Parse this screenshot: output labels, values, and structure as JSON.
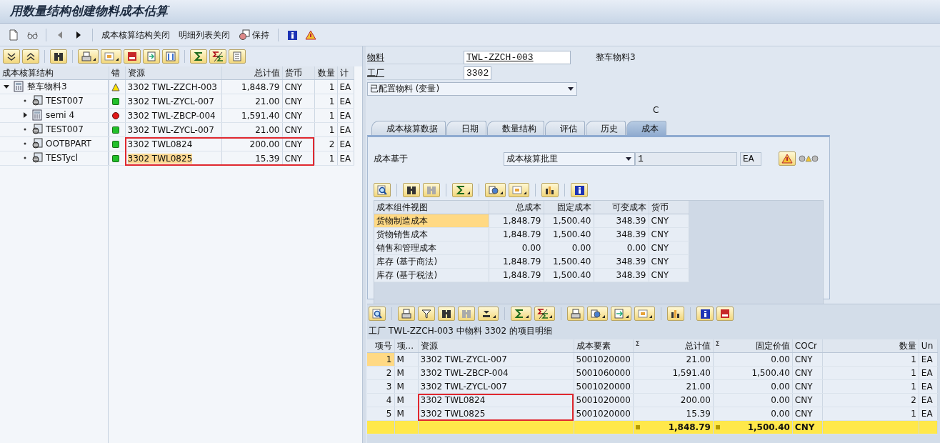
{
  "window": {
    "title": "用数量结构创建物料成本估算"
  },
  "toolbar": [
    {
      "kind": "text",
      "label": "成本核算结构关闭"
    },
    {
      "kind": "text",
      "label": "明细列表关闭"
    },
    {
      "kind": "icon_text",
      "label": "保持"
    }
  ],
  "tree": {
    "columns": [
      "成本核算结构",
      "错",
      "资源",
      "总计值",
      "货币",
      "数量",
      "计"
    ],
    "rows": [
      {
        "label": "整车物料3",
        "kind": "assembly",
        "expanded": true,
        "status": {
          "kind": "warning"
        },
        "resource": "3302 TWL-ZZCH-003",
        "total": "1,848.79",
        "currency": "CNY",
        "quantity": "1",
        "unit": "EA",
        "marked": false,
        "selected": false,
        "children": [
          {
            "label": "TEST007",
            "kind": "material",
            "status": {
              "kind": "ok"
            },
            "resource": "3302 TWL-ZYCL-007",
            "total": "21.00",
            "currency": "CNY",
            "quantity": "1",
            "unit": "EA",
            "marked": false,
            "selected": false
          },
          {
            "label": "semi 4",
            "kind": "assembly",
            "expanded": false,
            "status": {
              "kind": "error"
            },
            "resource": "3302 TWL-ZBCP-004",
            "total": "1,591.40",
            "currency": "CNY",
            "quantity": "1",
            "unit": "EA",
            "marked": false,
            "selected": false
          },
          {
            "label": "TEST007",
            "kind": "material",
            "status": {
              "kind": "ok"
            },
            "resource": "3302 TWL-ZYCL-007",
            "total": "21.00",
            "currency": "CNY",
            "quantity": "1",
            "unit": "EA",
            "marked": false,
            "selected": false
          },
          {
            "label": "OOTBPART",
            "kind": "material",
            "status": {
              "kind": "ok"
            },
            "resource": "3302 TWL0824",
            "total": "200.00",
            "currency": "CNY",
            "quantity": "2",
            "unit": "EA",
            "marked": true,
            "selected": false
          },
          {
            "label": "TESTycl",
            "kind": "material",
            "status": {
              "kind": "ok"
            },
            "resource": "3302 TWL0825",
            "total": "15.39",
            "currency": "CNY",
            "quantity": "1",
            "unit": "EA",
            "marked": true,
            "selected": true
          }
        ]
      }
    ]
  },
  "header": {
    "material_label": "物料",
    "material": "TWL-ZZCH-003",
    "material_text": "整车物料3",
    "plant_label": "工厂",
    "plant": "3302",
    "config": "已配置物料 (变量)",
    "indicator": "C"
  },
  "tabs": [
    {
      "label": "成本核算数据",
      "selected": false
    },
    {
      "label": "日期",
      "selected": false
    },
    {
      "label": "数量结构",
      "selected": false
    },
    {
      "label": "评估",
      "selected": false
    },
    {
      "label": "历史",
      "selected": false
    },
    {
      "label": "成本",
      "selected": true
    }
  ],
  "cost_basis": {
    "label": "成本基于",
    "value": "成本核算批里",
    "quantity": "1",
    "unit": "EA"
  },
  "components": {
    "columns": [
      "成本组件视图",
      "总成本",
      "固定成本",
      "可变成本",
      "货币"
    ],
    "rows": [
      {
        "name": "货物制造成本",
        "total": "1,848.79",
        "fixed": "1,500.40",
        "variable": "348.39",
        "currency": "CNY",
        "selected": true
      },
      {
        "name": "货物销售成本",
        "total": "1,848.79",
        "fixed": "1,500.40",
        "variable": "348.39",
        "currency": "CNY",
        "selected": false
      },
      {
        "name": "销售和管理成本",
        "total": "0.00",
        "fixed": "0.00",
        "variable": "0.00",
        "currency": "CNY",
        "selected": false
      },
      {
        "name": "库存 (基于商法)",
        "total": "1,848.79",
        "fixed": "1,500.40",
        "variable": "348.39",
        "currency": "CNY",
        "selected": false
      },
      {
        "name": "库存 (基于税法)",
        "total": "1,848.79",
        "fixed": "1,500.40",
        "variable": "348.39",
        "currency": "CNY",
        "selected": false
      }
    ]
  },
  "items": {
    "title": "工厂 TWL-ZZCH-003 中物料 3302 的项目明细",
    "columns": [
      {
        "label": "项号"
      },
      {
        "label": "项..."
      },
      {
        "label": "资源"
      },
      {
        "label": "成本要素"
      },
      {
        "label": "总计值",
        "sum_marker": "Σ"
      },
      {
        "label": "固定价值",
        "sum_marker": "Σ"
      },
      {
        "label": "COCr"
      },
      {
        "label": "数量"
      },
      {
        "label": "Un"
      }
    ],
    "rows": [
      {
        "no": "1",
        "type": "M",
        "resource": "3302 TWL-ZYCL-007",
        "element": "5001020000",
        "total": "21.00",
        "fixed": "0.00",
        "currency": "CNY",
        "quantity": "1",
        "unit": "EA",
        "selected": true,
        "marked": false
      },
      {
        "no": "2",
        "type": "M",
        "resource": "3302 TWL-ZBCP-004",
        "element": "5001060000",
        "total": "1,591.40",
        "fixed": "1,500.40",
        "currency": "CNY",
        "quantity": "1",
        "unit": "EA",
        "selected": false,
        "marked": false
      },
      {
        "no": "3",
        "type": "M",
        "resource": "3302 TWL-ZYCL-007",
        "element": "5001020000",
        "total": "21.00",
        "fixed": "0.00",
        "currency": "CNY",
        "quantity": "1",
        "unit": "EA",
        "selected": false,
        "marked": false
      },
      {
        "no": "4",
        "type": "M",
        "resource": "3302 TWL0824",
        "element": "5001020000",
        "total": "200.00",
        "fixed": "0.00",
        "currency": "CNY",
        "quantity": "2",
        "unit": "EA",
        "selected": false,
        "marked": true
      },
      {
        "no": "5",
        "type": "M",
        "resource": "3302 TWL0825",
        "element": "5001020000",
        "total": "15.39",
        "fixed": "0.00",
        "currency": "CNY",
        "quantity": "1",
        "unit": "EA",
        "selected": false,
        "marked": true
      }
    ],
    "totals": {
      "total": "1,848.79",
      "fixed": "1,500.40",
      "currency": "CNY"
    }
  }
}
